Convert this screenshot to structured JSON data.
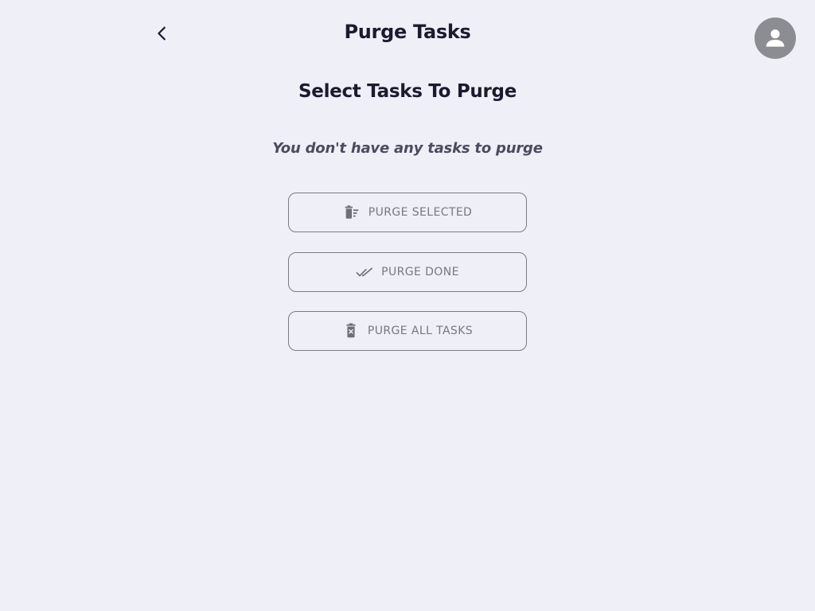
{
  "header": {
    "title": "Purge Tasks",
    "back_icon": "chevron-left-icon",
    "avatar_icon": "person-icon"
  },
  "main": {
    "section_title": "Select Tasks To Purge",
    "empty_message": "You don't have any tasks to purge",
    "actions": [
      {
        "label": "PURGE SELECTED",
        "icon": "trash-list-icon"
      },
      {
        "label": "PURGE DONE",
        "icon": "double-check-icon"
      },
      {
        "label": "PURGE ALL TASKS",
        "icon": "trash-x-icon"
      }
    ]
  },
  "colors": {
    "background": "#eeeff7",
    "text_primary": "#1a1b2e",
    "text_muted": "#77787f",
    "avatar_bg": "#8c8d93",
    "button_border": "#7a7b83"
  }
}
